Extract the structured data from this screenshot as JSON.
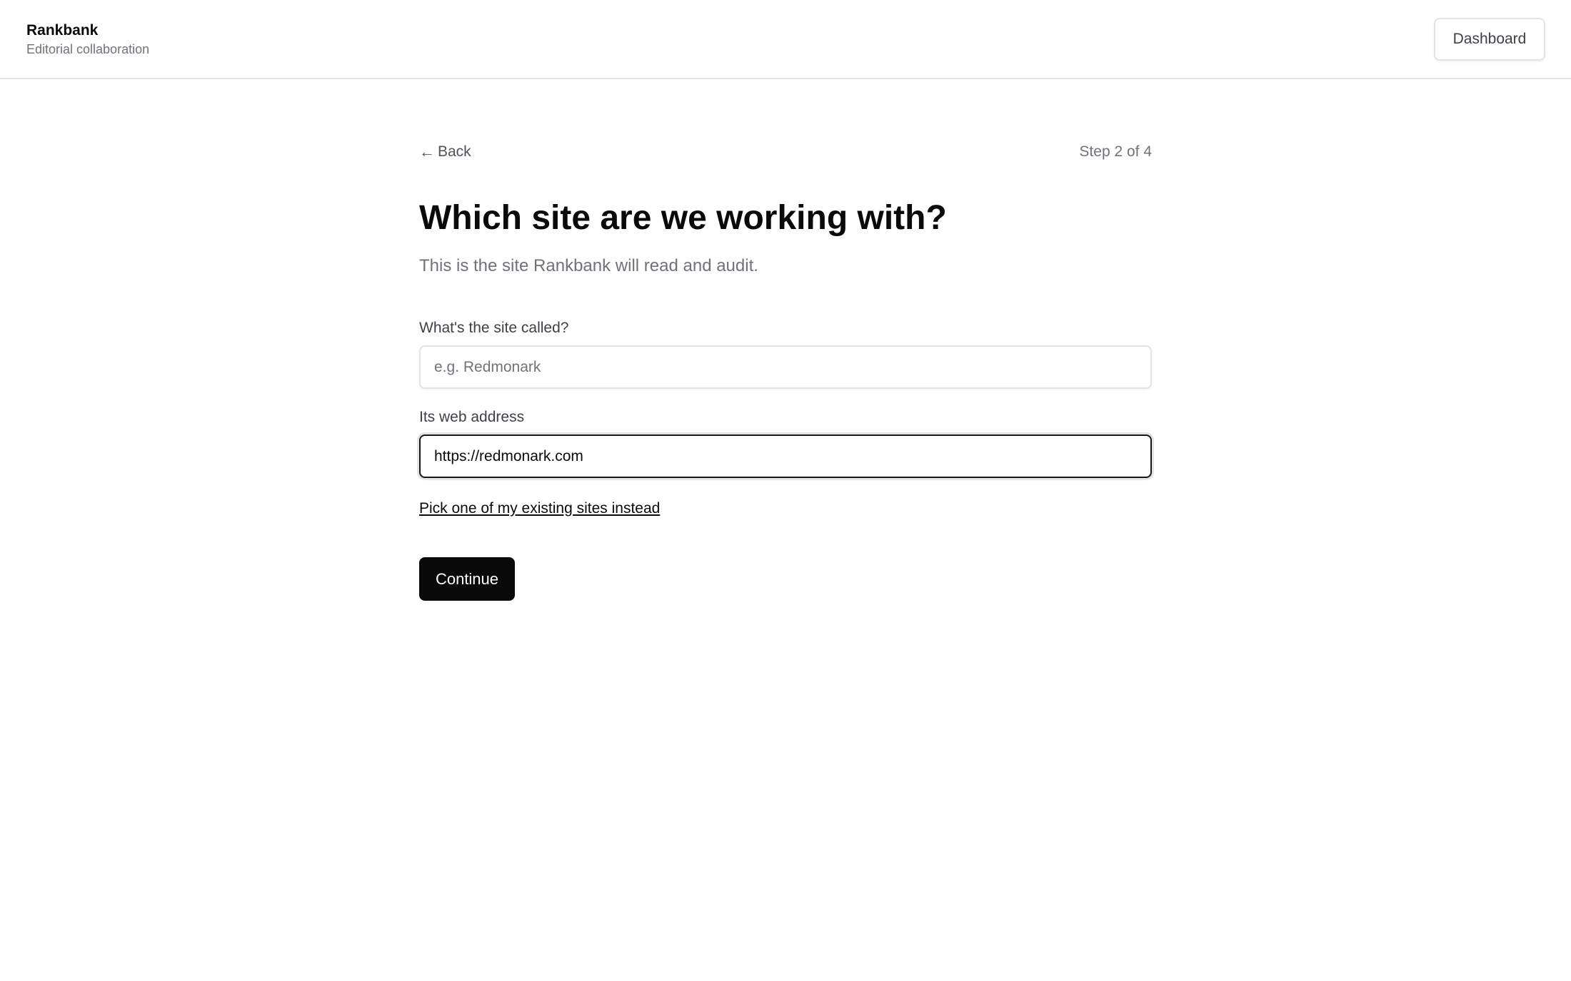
{
  "header": {
    "brand_name": "Rankbank",
    "brand_tagline": "Editorial collaboration",
    "dashboard_label": "Dashboard"
  },
  "nav": {
    "back_arrow": "←",
    "back_label": "Back",
    "step_indicator": "Step 2 of 4"
  },
  "main": {
    "title": "Which site are we working with?",
    "subtitle": "This is the site Rankbank will read and audit."
  },
  "form": {
    "site_name": {
      "label": "What's the site called?",
      "placeholder": "e.g. Redmonark",
      "value": ""
    },
    "web_address": {
      "label": "Its web address",
      "placeholder": "",
      "value": "https://redmonark.com"
    },
    "pick_existing_label": "Pick one of my existing sites instead",
    "continue_label": "Continue"
  }
}
